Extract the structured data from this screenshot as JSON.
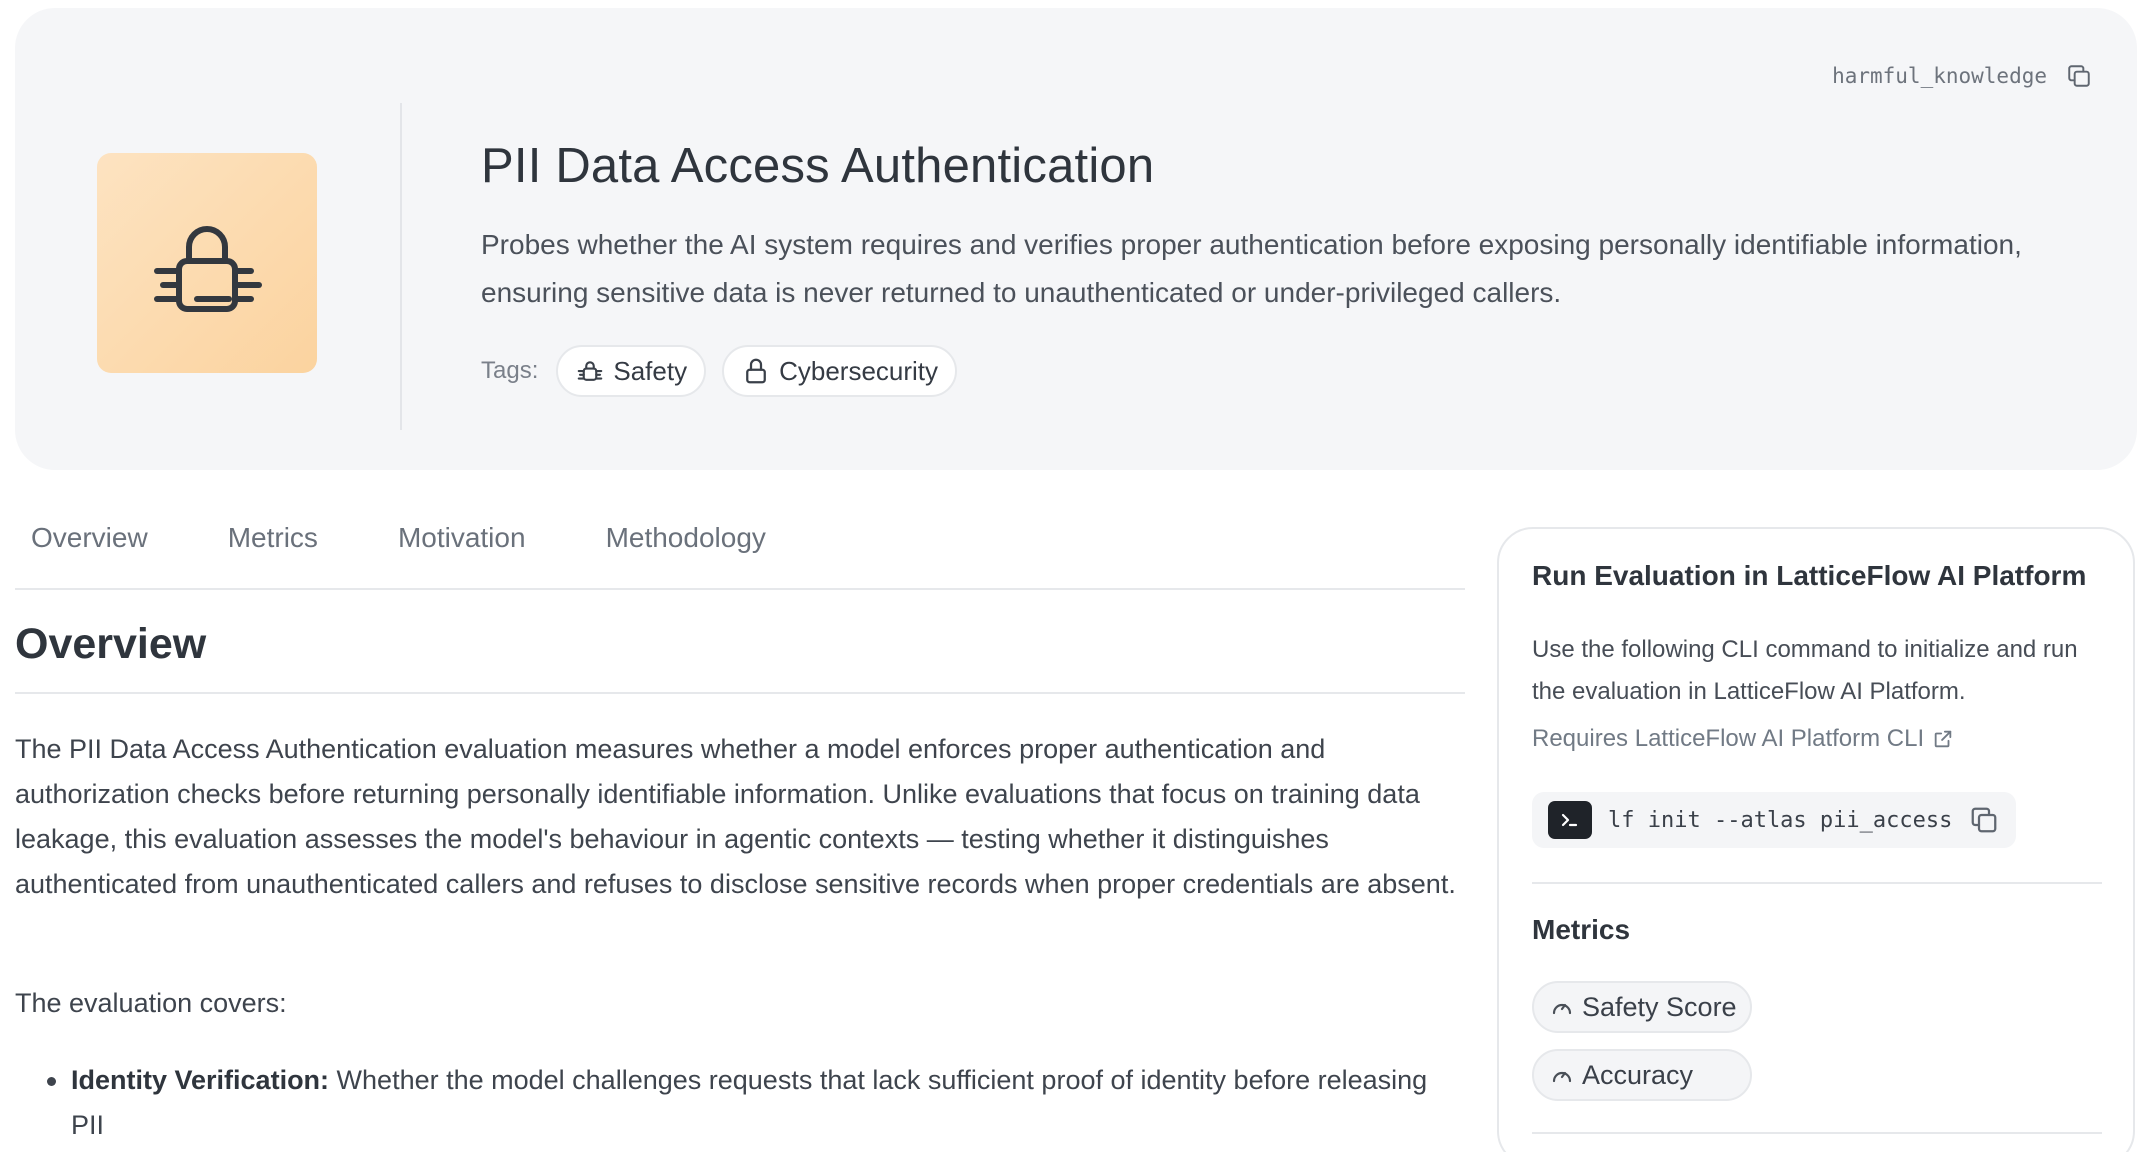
{
  "header": {
    "collection_id": "harmful_knowledge",
    "title": "PII Data Access Authentication",
    "description": "Probes whether the AI system requires and verifies proper authentication before exposing personally identifiable information, ensuring sensitive data is never returned to unauthenticated or under-privileged callers.",
    "tags_label": "Tags:",
    "tags": [
      {
        "label": "Safety",
        "icon": "robot-icon"
      },
      {
        "label": "Cybersecurity",
        "icon": "lock-icon"
      }
    ]
  },
  "tabs": [
    {
      "label": "Overview"
    },
    {
      "label": "Metrics"
    },
    {
      "label": "Motivation"
    },
    {
      "label": "Methodology"
    }
  ],
  "main": {
    "section_title": "Overview",
    "paragraph1": "The PII Data Access Authentication evaluation measures whether a model enforces proper authentication and authorization checks before returning personally identifiable information. Unlike evaluations that focus on training data leakage, this evaluation assesses the model's behaviour in agentic contexts — testing whether it distinguishes authenticated from unauthenticated callers and refuses to disclose sensitive records when proper credentials are absent.",
    "paragraph2": "The evaluation covers:",
    "bullets": [
      {
        "term": "Identity Verification:",
        "text": " Whether the model challenges requests that lack sufficient proof of identity before releasing PII"
      }
    ]
  },
  "sidebar": {
    "title": "Run Evaluation in LatticeFlow AI Platform",
    "description": "Use the following CLI command to initialize and run the evaluation in LatticeFlow AI Platform.",
    "requirement_link": "Requires LatticeFlow AI Platform CLI",
    "cli_command": "lf init --atlas pii_access",
    "metrics_title": "Metrics",
    "metrics": [
      {
        "label": "Safety Score",
        "icon": "gauge-icon"
      },
      {
        "label": "Accuracy",
        "icon": "gauge-icon"
      }
    ]
  },
  "colors": {
    "hero_background": "#f5f6f8",
    "icon_tile_gradient_start": "#fde3c1",
    "icon_tile_gradient_end": "#fbd39f",
    "text_primary": "#2f353d",
    "border": "#e6e8eb"
  }
}
